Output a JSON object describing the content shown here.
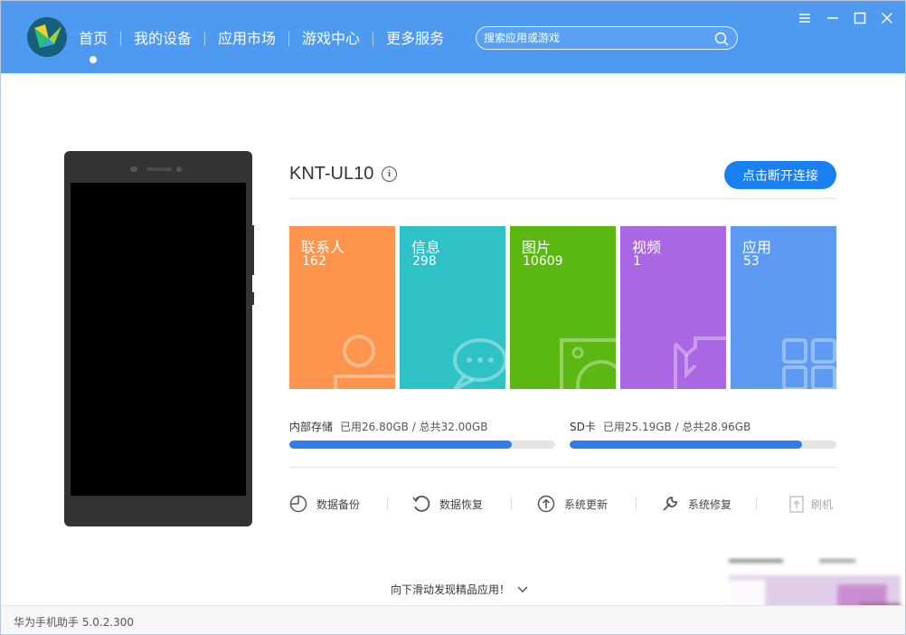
{
  "nav": {
    "items": [
      {
        "label": "首页",
        "active": true
      },
      {
        "label": "我的设备"
      },
      {
        "label": "应用市场"
      },
      {
        "label": "游戏中心"
      },
      {
        "label": "更多服务"
      }
    ]
  },
  "search": {
    "placeholder": "搜索应用或游戏"
  },
  "device": {
    "name": "KNT-UL10",
    "disconnect_label": "点击断开连接"
  },
  "tiles": [
    {
      "label": "联系人",
      "count": "162",
      "color": "#ff944d",
      "icon": "contact-icon"
    },
    {
      "label": "信息",
      "count": "298",
      "color": "#2ec2c7",
      "icon": "message-icon"
    },
    {
      "label": "图片",
      "count": "10609",
      "color": "#5bb712",
      "icon": "image-icon"
    },
    {
      "label": "视频",
      "count": "1",
      "color": "#a967e3",
      "icon": "video-icon"
    },
    {
      "label": "应用",
      "count": "53",
      "color": "#5d9af2",
      "icon": "apps-icon"
    }
  ],
  "storage": {
    "internal": {
      "label": "内部存储",
      "detail": "已用26.80GB / 总共32.00GB",
      "used_fraction": 0.8375
    },
    "sd": {
      "label": "SD卡",
      "detail": "已用25.19GB / 总共28.96GB",
      "used_fraction": 0.8698
    }
  },
  "tools": [
    {
      "label": "数据备份",
      "icon": "backup-icon"
    },
    {
      "label": "数据恢复",
      "icon": "restore-icon"
    },
    {
      "label": "系统更新",
      "icon": "update-icon"
    },
    {
      "label": "系统修复",
      "icon": "repair-icon"
    },
    {
      "label": "刷机",
      "icon": "flash-icon",
      "disabled": true
    }
  ],
  "scroll_hint": "向下滑动发现精品应用！",
  "footer": {
    "version_text": "华为手机助手 5.0.2.300"
  },
  "colors": {
    "header": "#4d9af0",
    "accent": "#1a7ff0"
  }
}
